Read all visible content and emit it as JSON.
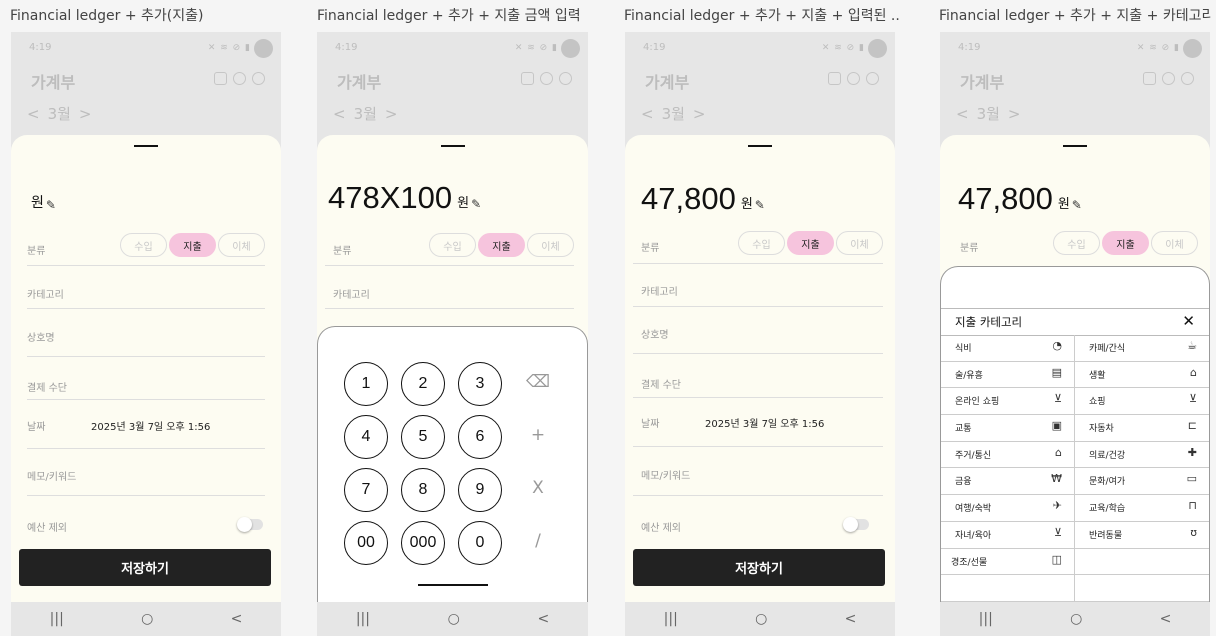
{
  "screens": [
    {
      "title": "Financial ledger + 추가(지출)"
    },
    {
      "title": "Financial ledger + 추가 + 지출 금액 입력"
    },
    {
      "title": "Financial ledger + 추가 + 지출 + 입력된 ..."
    },
    {
      "title": "Financial ledger + 추가 + 지출 + 카테고리"
    }
  ],
  "status": {
    "time": "4:19",
    "icons": "✕ ≋ ⊘ ▮"
  },
  "app": {
    "title": "가계부",
    "month_prev": "<",
    "month": "3월",
    "month_next": ">"
  },
  "form": {
    "currency": "원",
    "amount_keypad": "478X100",
    "amount_final": "47,800",
    "type_label": "분류",
    "types": [
      "수입",
      "지출",
      "이체"
    ],
    "category_label": "카테고리",
    "merchant_label": "상호명",
    "payment_label": "결제 수단",
    "date_label": "날짜",
    "date_value": "2025년 3월 7일 오후 1:56",
    "memo_label": "메모/키워드",
    "exclude_label": "예산 제외",
    "save_label": "저장하기"
  },
  "keypad": {
    "keys": [
      "1",
      "2",
      "3",
      "4",
      "5",
      "6",
      "7",
      "8",
      "9",
      "00",
      "000",
      "0"
    ],
    "ops": [
      "⌫",
      "+",
      "X",
      "/"
    ]
  },
  "categories": {
    "title": "지출 카테고리",
    "close": "✕",
    "items": [
      {
        "label": "식비",
        "icon": "◔",
        "icon_name": "rice-bowl-icon"
      },
      {
        "label": "카페/간식",
        "icon": "☕",
        "icon_name": "coffee-cup-icon"
      },
      {
        "label": "술/유흥",
        "icon": "▤",
        "icon_name": "beer-icon"
      },
      {
        "label": "생활",
        "icon": "⌂",
        "icon_name": "basket-icon"
      },
      {
        "label": "온라인 쇼핑",
        "icon": "⊻",
        "icon_name": "cart-icon"
      },
      {
        "label": "쇼핑",
        "icon": "⊻",
        "icon_name": "shopping-cart-icon"
      },
      {
        "label": "교통",
        "icon": "▣",
        "icon_name": "bus-icon"
      },
      {
        "label": "자동차",
        "icon": "⊏",
        "icon_name": "car-icon"
      },
      {
        "label": "주거/통신",
        "icon": "⌂",
        "icon_name": "house-icon"
      },
      {
        "label": "의료/건강",
        "icon": "✚",
        "icon_name": "medical-kit-icon"
      },
      {
        "label": "금융",
        "icon": "₩",
        "icon_name": "won-icon"
      },
      {
        "label": "문화/여가",
        "icon": "▭",
        "icon_name": "ticket-icon"
      },
      {
        "label": "여행/숙박",
        "icon": "✈",
        "icon_name": "airplane-icon"
      },
      {
        "label": "교육/학습",
        "icon": "⊓",
        "icon_name": "book-icon"
      },
      {
        "label": "자녀/육아",
        "icon": "⊻",
        "icon_name": "stroller-icon"
      },
      {
        "label": "반려동물",
        "icon": "ʊ",
        "icon_name": "pet-icon"
      },
      {
        "label": "경조/선물",
        "icon": "◫",
        "icon_name": "gift-icon"
      }
    ]
  },
  "nav": {
    "recent": "|||",
    "home": "○",
    "back": "<"
  }
}
